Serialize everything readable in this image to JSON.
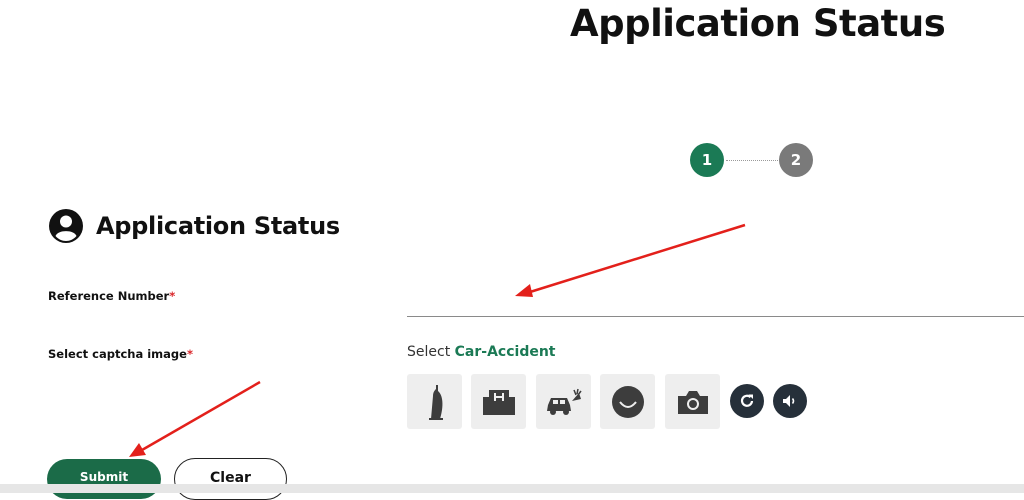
{
  "page": {
    "title": "Application Status"
  },
  "stepper": {
    "steps": [
      "1",
      "2"
    ],
    "active_step": 1
  },
  "section": {
    "title": "Application Status",
    "icon": "user-circle-icon"
  },
  "form": {
    "reference_label": "Reference Number",
    "reference_value": "",
    "required_mark": "*",
    "captcha_label": "Select captcha image",
    "captcha_prompt": "Select",
    "captcha_target": "Car-Accident",
    "captcha_tiles": [
      "tower-icon",
      "hospital-icon",
      "car-accident-icon",
      "smile-icon",
      "camera-icon"
    ],
    "refresh_icon": "refresh-icon",
    "audio_icon": "speaker-icon"
  },
  "buttons": {
    "submit": "Submit",
    "clear": "Clear"
  },
  "colors": {
    "primary_green": "#1b7a55",
    "step_inactive": "#7a7a7a",
    "icon_button": "#26303a",
    "annotation_arrow": "#e3201b"
  }
}
